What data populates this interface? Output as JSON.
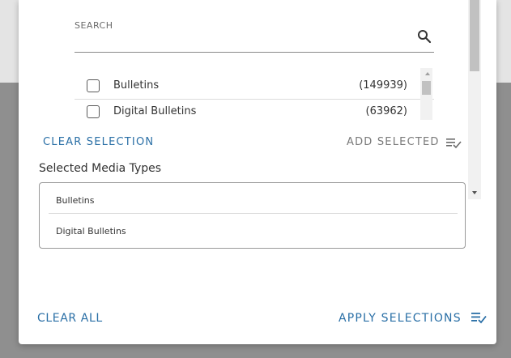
{
  "search": {
    "label": "SEARCH",
    "value": ""
  },
  "media_list": {
    "items": [
      {
        "label": "Bulletins",
        "count": "(149939)",
        "checked": false
      },
      {
        "label": "Digital Bulletins",
        "count": "(63962)",
        "checked": false
      }
    ]
  },
  "actions": {
    "clear_selection": "CLEAR SELECTION",
    "add_selected": "ADD SELECTED"
  },
  "selected": {
    "title": "Selected Media Types",
    "items": [
      "Bulletins",
      "Digital Bulletins"
    ]
  },
  "footer": {
    "clear_all": "CLEAR ALL",
    "apply_selections": "APPLY SELECTIONS"
  },
  "colors": {
    "accent": "#2a6fa6",
    "disabled_text": "#7a7a7a",
    "overlay": "#8f8f8f"
  },
  "icons": {
    "search": "search-icon",
    "add_selected": "playlist-check-icon",
    "apply": "playlist-check-icon"
  }
}
